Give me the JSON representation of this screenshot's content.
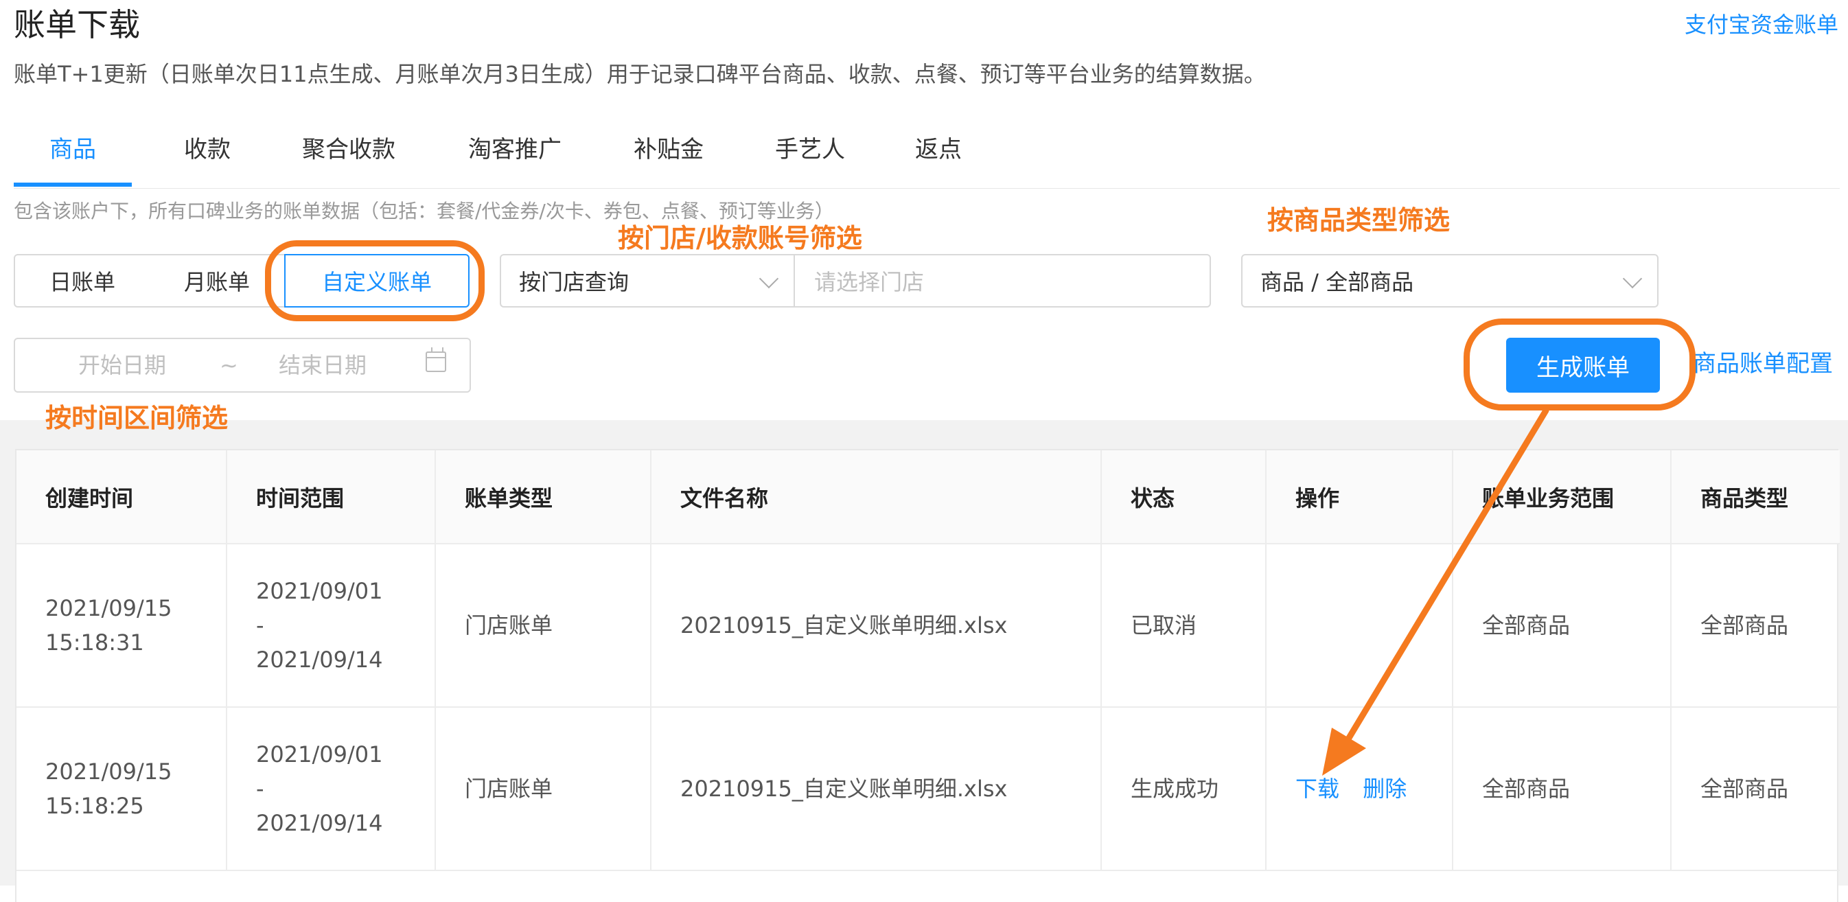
{
  "page": {
    "title": "账单下载",
    "top_link": "支付宝资金账单",
    "description": "账单T+1更新（日账单次日11点生成、月账单次月3日生成）用于记录口碑平台商品、收款、点餐、预订等平台业务的结算数据。"
  },
  "tabs": [
    {
      "label": "商品",
      "active": true
    },
    {
      "label": "收款"
    },
    {
      "label": "聚合收款"
    },
    {
      "label": "淘客推广"
    },
    {
      "label": "补贴金"
    },
    {
      "label": "手艺人"
    },
    {
      "label": "返点"
    }
  ],
  "tab_note": "包含该账户下，所有口碑业务的账单数据（包括：套餐/代金券/次卡、券包、点餐、预订等业务）",
  "filters": {
    "period_buttons": [
      "日账单",
      "月账单",
      "自定义账单"
    ],
    "active_period": "自定义账单",
    "store_select": "按门店查询",
    "store_placeholder": "请选择门店",
    "goods_select": "商品 / 全部商品",
    "start_placeholder": "开始日期",
    "range_separator": "~",
    "end_placeholder": "结束日期",
    "generate_button": "生成账单",
    "config_link": "商品账单配置"
  },
  "annotations": {
    "store_filter": "按门店/收款账号筛选",
    "goods_filter": "按商品类型筛选",
    "time_filter": "按时间区间筛选",
    "color": "#f57a1f"
  },
  "table": {
    "columns": [
      "创建时间",
      "时间范围",
      "账单类型",
      "文件名称",
      "状态",
      "操作",
      "账单业务范围",
      "商品类型"
    ],
    "rows": [
      {
        "created_date": "2021/09/15",
        "created_time": "15:18:31",
        "range_start": "2021/09/01",
        "range_sep": "-",
        "range_end": "2021/09/14",
        "type": "门店账单",
        "file": "20210915_自定义账单明细.xlsx",
        "status": "已取消",
        "actions": [],
        "scope": "全部商品",
        "goods_type": "全部商品"
      },
      {
        "created_date": "2021/09/15",
        "created_time": "15:18:25",
        "range_start": "2021/09/01",
        "range_sep": "-",
        "range_end": "2021/09/14",
        "type": "门店账单",
        "file": "20210915_自定义账单明细.xlsx",
        "status": "生成成功",
        "actions": [
          "下载",
          "删除"
        ],
        "scope": "全部商品",
        "goods_type": "全部商品"
      }
    ]
  },
  "colors": {
    "accent": "#1890ff"
  }
}
